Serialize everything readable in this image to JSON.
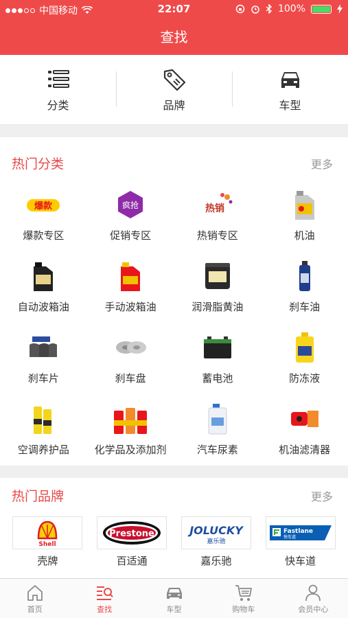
{
  "status": {
    "carrier": "中国移动",
    "time": "22:07",
    "battery": "100%"
  },
  "nav": {
    "title": "查找"
  },
  "quick_tabs": [
    {
      "label": "分类",
      "icon": "list-icon"
    },
    {
      "label": "品牌",
      "icon": "tag-icon"
    },
    {
      "label": "车型",
      "icon": "car-icon"
    }
  ],
  "hot_categories": {
    "title": "热门分类",
    "more": "更多",
    "items": [
      {
        "label": "爆款专区",
        "icon": "hot-deal-icon"
      },
      {
        "label": "促销专区",
        "icon": "promotion-icon"
      },
      {
        "label": "热销专区",
        "icon": "best-seller-icon"
      },
      {
        "label": "机油",
        "icon": "engine-oil-icon"
      },
      {
        "label": "自动波箱油",
        "icon": "auto-transmission-oil-icon"
      },
      {
        "label": "手动波箱油",
        "icon": "manual-transmission-oil-icon"
      },
      {
        "label": "润滑脂黄油",
        "icon": "grease-icon"
      },
      {
        "label": "刹车油",
        "icon": "brake-fluid-icon"
      },
      {
        "label": "刹车片",
        "icon": "brake-pad-icon"
      },
      {
        "label": "刹车盘",
        "icon": "brake-disc-icon"
      },
      {
        "label": "蓄电池",
        "icon": "battery-icon"
      },
      {
        "label": "防冻液",
        "icon": "antifreeze-icon"
      },
      {
        "label": "空调养护品",
        "icon": "ac-care-icon"
      },
      {
        "label": "化学品及添加剂",
        "icon": "additive-icon"
      },
      {
        "label": "汽车尿素",
        "icon": "urea-icon"
      },
      {
        "label": "机油滤清器",
        "icon": "oil-filter-icon"
      }
    ]
  },
  "hot_brands": {
    "title": "热门品牌",
    "more": "更多",
    "items": [
      {
        "label": "壳牌",
        "logo_text": "Shell"
      },
      {
        "label": "百适通",
        "logo_text": "Prestone"
      },
      {
        "label": "嘉乐驰",
        "logo_text": "JOLUCKY",
        "logo_sub": "嘉乐驰"
      },
      {
        "label": "快车道",
        "logo_text": "Fastlane",
        "logo_sub": "快车道"
      }
    ]
  },
  "tabbar": [
    {
      "label": "首页",
      "icon": "home-icon",
      "active": false
    },
    {
      "label": "查找",
      "icon": "search-list-icon",
      "active": true
    },
    {
      "label": "车型",
      "icon": "car-icon",
      "active": false
    },
    {
      "label": "购物车",
      "icon": "cart-icon",
      "active": false
    },
    {
      "label": "会员中心",
      "icon": "user-icon",
      "active": false
    }
  ],
  "colors": {
    "primary": "#ef4a4a",
    "accent_text": "#e84a4a"
  }
}
